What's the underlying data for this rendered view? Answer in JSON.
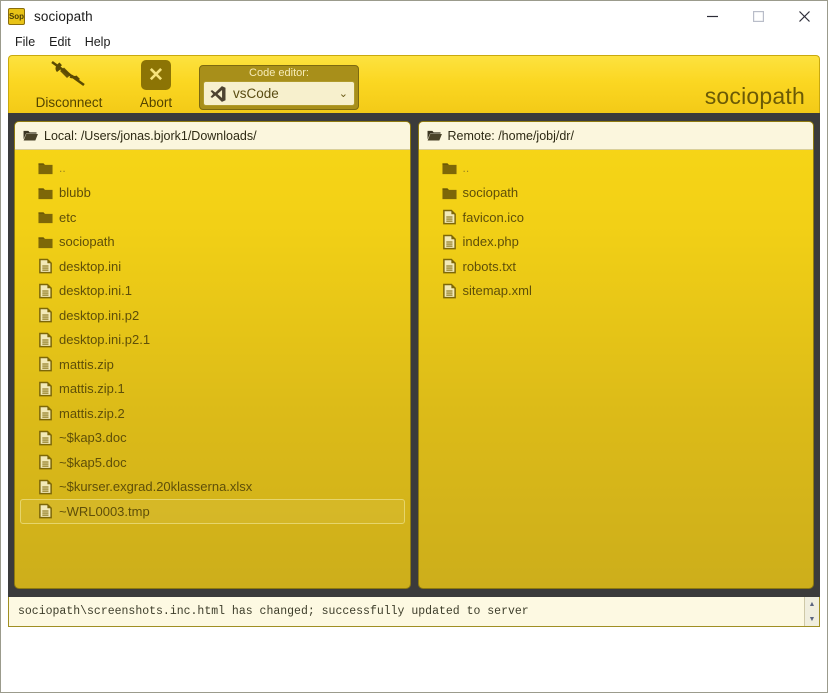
{
  "window": {
    "title": "sociopath",
    "app_icon_text": "Sop",
    "controls": {
      "minimize": "minimize-icon",
      "maximize": "maximize-icon",
      "close": "close-icon"
    }
  },
  "menubar": {
    "items": [
      "File",
      "Edit",
      "Help"
    ]
  },
  "toolbar": {
    "disconnect_label": "Disconnect",
    "disconnect_icon": "phone-hangup-icon",
    "abort_label": "Abort",
    "abort_icon": "x-mark-icon",
    "editor_caption": "Code editor:",
    "editor_value": "vsCode",
    "editor_icon": "vscode-logo-icon",
    "editor_chevron": "chevron-down-icon",
    "brand": "sociopath"
  },
  "panels": {
    "local": {
      "header": "Local: /Users/jonas.bjork1/Downloads/",
      "header_icon": "folder-open-icon",
      "items": [
        {
          "name": "..",
          "type": "folder",
          "selected": false
        },
        {
          "name": "blubb",
          "type": "folder",
          "selected": false
        },
        {
          "name": "etc",
          "type": "folder",
          "selected": false
        },
        {
          "name": "sociopath",
          "type": "folder",
          "selected": false
        },
        {
          "name": "desktop.ini",
          "type": "file",
          "selected": false
        },
        {
          "name": "desktop.ini.1",
          "type": "file",
          "selected": false
        },
        {
          "name": "desktop.ini.p2",
          "type": "file",
          "selected": false
        },
        {
          "name": "desktop.ini.p2.1",
          "type": "file",
          "selected": false
        },
        {
          "name": "mattis.zip",
          "type": "file",
          "selected": false
        },
        {
          "name": "mattis.zip.1",
          "type": "file",
          "selected": false
        },
        {
          "name": "mattis.zip.2",
          "type": "file",
          "selected": false
        },
        {
          "name": "~$kap3.doc",
          "type": "file",
          "selected": false
        },
        {
          "name": "~$kap5.doc",
          "type": "file",
          "selected": false
        },
        {
          "name": "~$kurser.exgrad.20klasserna.xlsx",
          "type": "file",
          "selected": false
        },
        {
          "name": "~WRL0003.tmp",
          "type": "file",
          "selected": true
        }
      ]
    },
    "remote": {
      "header": "Remote: /home/jobj/dr/",
      "header_icon": "folder-open-icon",
      "items": [
        {
          "name": "..",
          "type": "folder",
          "selected": false
        },
        {
          "name": "sociopath",
          "type": "folder",
          "selected": false
        },
        {
          "name": "favicon.ico",
          "type": "file",
          "selected": false
        },
        {
          "name": "index.php",
          "type": "file",
          "selected": false
        },
        {
          "name": "robots.txt",
          "type": "file",
          "selected": false
        },
        {
          "name": "sitemap.xml",
          "type": "file",
          "selected": false
        }
      ]
    }
  },
  "statusbar": {
    "log": "sociopath\\screenshots.inc.html has changed; successfully updated to server",
    "scroll_up": "▲",
    "scroll_down": "▼"
  },
  "colors": {
    "brand_yellow": "#f7d617",
    "toolbar_top": "#fde23f",
    "panel_gold": "#cdae1b",
    "dark_frame": "#3b3b3b",
    "header_cream": "#fbf6dd",
    "text_olive": "#5f4f09"
  }
}
